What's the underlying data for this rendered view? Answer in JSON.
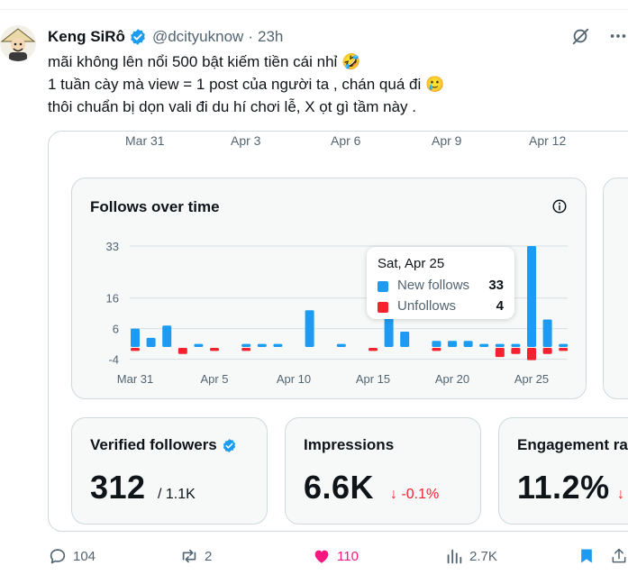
{
  "tweet": {
    "author_name": "Keng SiRô",
    "handle": "@dcityuknow",
    "separator": "·",
    "time": "23h",
    "lines": [
      "mãi không lên nổi 500 bật kiếm tiền cái nhỉ 🤣",
      "1 tuần cày mà view = 1 post của người ta , chán quá đi 🥲",
      "thôi chuẩn bị dọn vali đi du hí chơi lễ, X ọt gì tầm này ."
    ]
  },
  "icons": {
    "verified": "verified-badge-icon",
    "grok": "grok-icon",
    "more": "more-icon",
    "info": "info-icon",
    "reply": "reply-icon",
    "repost": "repost-icon",
    "like": "like-icon",
    "views": "views-icon",
    "bookmark": "bookmark-icon",
    "share": "share-icon"
  },
  "colors": {
    "accent": "#1d9bf0",
    "new_follows": "#1d9bf0",
    "unfollows": "#f4212e",
    "like": "#f91880"
  },
  "top_axis_labels": [
    "Mar 31",
    "Apr 3",
    "Apr 6",
    "Apr 9",
    "Apr 12"
  ],
  "panel": {
    "title": "Follows over time"
  },
  "chart_data": {
    "type": "bar",
    "title": "Follows over time",
    "x_tick_labels": [
      "Mar 31",
      "Apr 5",
      "Apr 10",
      "Apr 15",
      "Apr 20",
      "Apr 25"
    ],
    "y_tick_labels": [
      "33",
      "16",
      "6",
      "-4"
    ],
    "ylim": [
      -4,
      33
    ],
    "grid": true,
    "categories": [
      "Mar 31",
      "Apr 1",
      "Apr 2",
      "Apr 3",
      "Apr 4",
      "Apr 5",
      "Apr 6",
      "Apr 7",
      "Apr 8",
      "Apr 9",
      "Apr 10",
      "Apr 11",
      "Apr 12",
      "Apr 13",
      "Apr 14",
      "Apr 15",
      "Apr 16",
      "Apr 17",
      "Apr 18",
      "Apr 19",
      "Apr 20",
      "Apr 21",
      "Apr 22",
      "Apr 23",
      "Apr 24",
      "Apr 25",
      "Apr 26",
      "Apr 27"
    ],
    "series": [
      {
        "name": "New follows",
        "values": [
          6,
          3,
          7,
          0,
          1,
          0,
          0,
          1,
          1,
          1,
          0,
          12,
          0,
          1,
          0,
          0,
          12,
          5,
          0,
          2,
          2,
          2,
          1,
          1,
          1,
          33,
          9,
          1
        ]
      },
      {
        "name": "Unfollows",
        "values": [
          1,
          0,
          0,
          2,
          0,
          1,
          0,
          1,
          0,
          0,
          0,
          0,
          0,
          0,
          0,
          1,
          0,
          0,
          0,
          1,
          0,
          0,
          0,
          3,
          2,
          4,
          2,
          1
        ]
      }
    ],
    "tooltip": {
      "date": "Sat, Apr 25",
      "rows": [
        {
          "label": "New follows",
          "value": "33"
        },
        {
          "label": "Unfollows",
          "value": "4"
        }
      ]
    }
  },
  "stats": [
    {
      "title": "Verified followers",
      "value": "312",
      "sub": "/ 1.1K",
      "delta": ""
    },
    {
      "title": "Impressions",
      "value": "6.6K",
      "sub": "",
      "delta": "↓ -0.1%"
    },
    {
      "title": "Engagement rate",
      "value": "11.2%",
      "sub": "",
      "delta": "↓"
    }
  ],
  "actions": {
    "replies": "104",
    "reposts": "2",
    "likes": "110",
    "views": "2.7K"
  }
}
